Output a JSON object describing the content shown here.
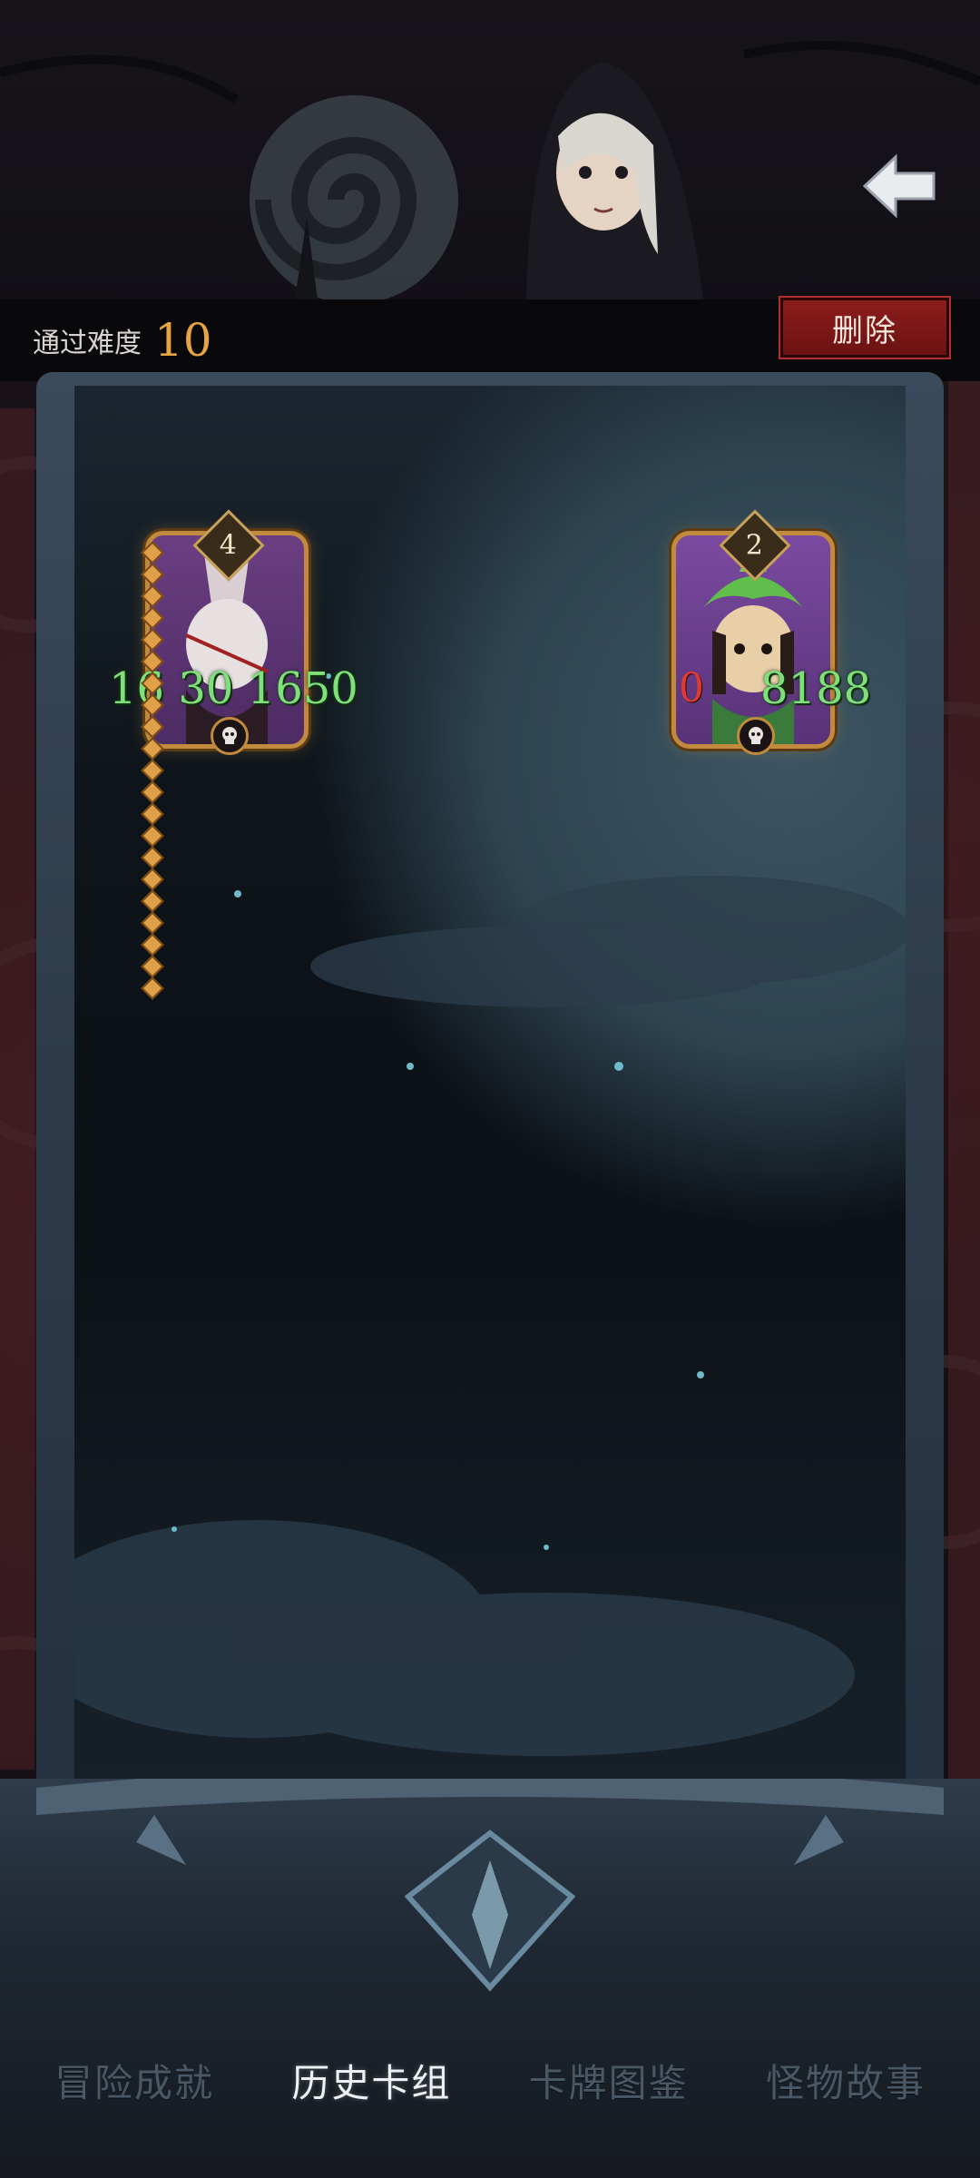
{
  "header": {
    "difficulty_label": "通过难度",
    "difficulty_value": "10",
    "delete_label": "删除"
  },
  "cards": [
    {
      "level": "4",
      "stats": "16 30 1650",
      "side": "left"
    },
    {
      "level": "2",
      "stats": "8188",
      "red_stat": "0",
      "side": "right"
    }
  ],
  "tabs": [
    {
      "label": "冒险成就",
      "active": false
    },
    {
      "label": "历史卡组",
      "active": true
    },
    {
      "label": "卡牌图鉴",
      "active": false
    },
    {
      "label": "怪物故事",
      "active": false
    }
  ],
  "colors": {
    "accent_gold": "#e7a443",
    "stat_green": "#7fe07a",
    "delete_red": "#8e1d1d",
    "tab_active": "#eef1f4",
    "tab_inactive": "#4a5866"
  }
}
